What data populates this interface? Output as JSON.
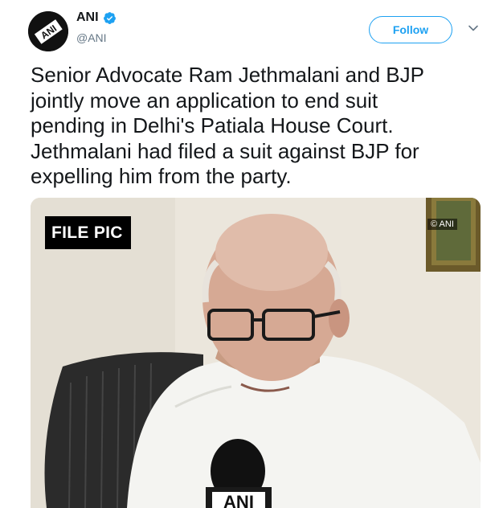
{
  "author": {
    "name": "ANI",
    "handle": "@ANI",
    "avatar_text": "ANI",
    "verified": true
  },
  "actions": {
    "follow_label": "Follow",
    "menu_icon": "chevron-down-icon"
  },
  "tweet": {
    "text": "Senior Advocate Ram Jethmalani and BJP\njointly move an application to end suit\npending in Delhi's Patiala House Court.\nJethmalani had filed a suit against BJP for\nexpelling him from the party."
  },
  "media": {
    "caption_overlay": "FILE PIC",
    "watermark": "© ANI",
    "mic_logo_text": "ANI"
  },
  "colors": {
    "accent": "#1da1f2",
    "text": "#14171a",
    "secondary": "#657786"
  }
}
